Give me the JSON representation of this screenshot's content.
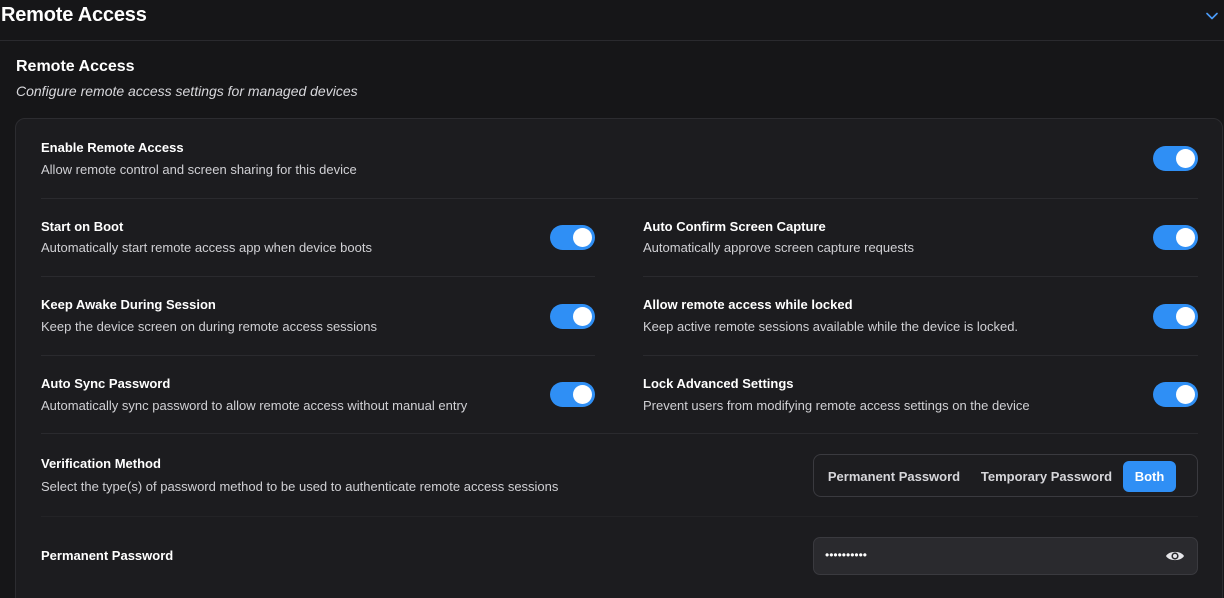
{
  "header": {
    "title": "Remote Access",
    "collapse_icon": "chevron-down-icon"
  },
  "section": {
    "title": "Remote Access",
    "description": "Configure remote access settings for managed devices"
  },
  "settings": {
    "enable_remote_access": {
      "label": "Enable Remote Access",
      "description": "Allow remote control and screen sharing for this device",
      "enabled": true
    },
    "start_on_boot": {
      "label": "Start on Boot",
      "description": "Automatically start remote access app when device boots",
      "enabled": true
    },
    "auto_confirm_capture": {
      "label": "Auto Confirm Screen Capture",
      "description": "Automatically approve screen capture requests",
      "enabled": true
    },
    "keep_awake": {
      "label": "Keep Awake During Session",
      "description": "Keep the device screen on during remote access sessions",
      "enabled": true
    },
    "allow_while_locked": {
      "label": "Allow remote access while locked",
      "description": "Keep active remote sessions available while the device is locked.",
      "enabled": true
    },
    "auto_sync_password": {
      "label": "Auto Sync Password",
      "description": "Automatically sync password to allow remote access without manual entry",
      "enabled": true
    },
    "lock_advanced": {
      "label": "Lock Advanced Settings",
      "description": "Prevent users from modifying remote access settings on the device",
      "enabled": true
    }
  },
  "verification": {
    "label": "Verification Method",
    "description": "Select the type(s) of password method to be used to authenticate remote access sessions",
    "options": [
      "Permanent Password",
      "Temporary Password",
      "Both"
    ],
    "selected": "Both"
  },
  "permanent_password": {
    "label": "Permanent Password",
    "value": "••••••••••",
    "reveal_icon": "eye-icon"
  },
  "colors": {
    "accent": "#2f8ff5",
    "background": "#161618",
    "panel": "#1c1c1f"
  }
}
